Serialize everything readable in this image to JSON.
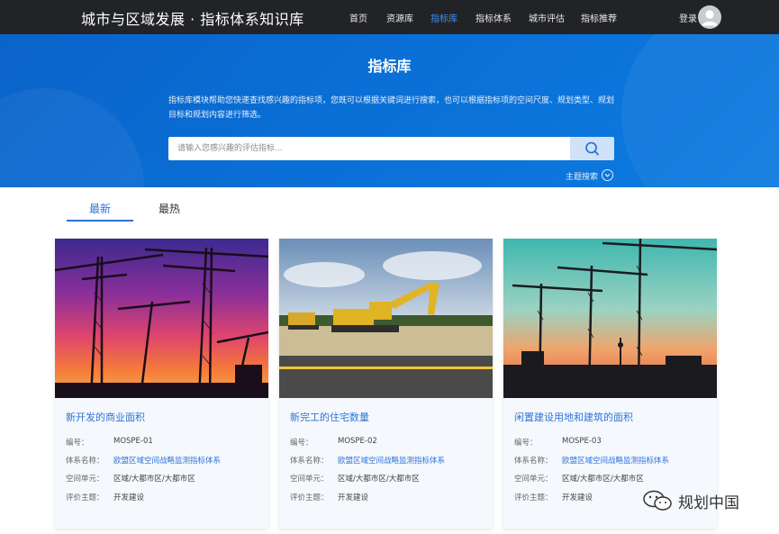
{
  "header": {
    "site_title": "城市与区域发展 · 指标体系知识库",
    "nav": [
      "首页",
      "资源库",
      "指标库",
      "指标体系",
      "城市评估",
      "指标推荐"
    ],
    "active_nav": "指标库",
    "login_label": "登录",
    "avatar_icon": "user-avatar-icon"
  },
  "hero": {
    "title": "指标库",
    "description": "指标库模块帮助您快速查找感兴趣的指标项，您既可以根据关键词进行搜索，也可以根据指标项的空间尺度、规划类型、规划目标和规划内容进行筛选。",
    "search_placeholder": "请输入您感兴趣的评估指标...",
    "search_icon": "search-icon",
    "topic_search_label": "主题搜索",
    "topic_search_icon": "chevron-down-circle-icon"
  },
  "tabs": {
    "newest": "最新",
    "hot": "最热",
    "active": "最新"
  },
  "field_labels": {
    "code": "编号：",
    "system": "体系名称：",
    "unit": "空间单元：",
    "theme": "评价主题："
  },
  "cards": [
    {
      "title": "新开发的商业面积",
      "code": "MOSPE-01",
      "system": "欧盟区域空间战略监测指标体系",
      "unit": "区域/大都市区/大都市区",
      "theme": "开发建设"
    },
    {
      "title": "新完工的住宅数量",
      "code": "MOSPE-02",
      "system": "欧盟区域空间战略监测指标体系",
      "unit": "区域/大都市区/大都市区",
      "theme": "开发建设"
    },
    {
      "title": "闲置建设用地和建筑的面积",
      "code": "MOSPE-03",
      "system": "欧盟区域空间战略监测指标体系",
      "unit": "区域/大都市区/大都市区",
      "theme": "开发建设"
    }
  ],
  "watermark": {
    "text": "规划中国",
    "icon": "wechat-icon"
  },
  "colors": {
    "topbar": "#222326",
    "hero_blue": "#0a6fd6",
    "accent": "#2f73d8",
    "card_bg": "#f5f8fc"
  }
}
